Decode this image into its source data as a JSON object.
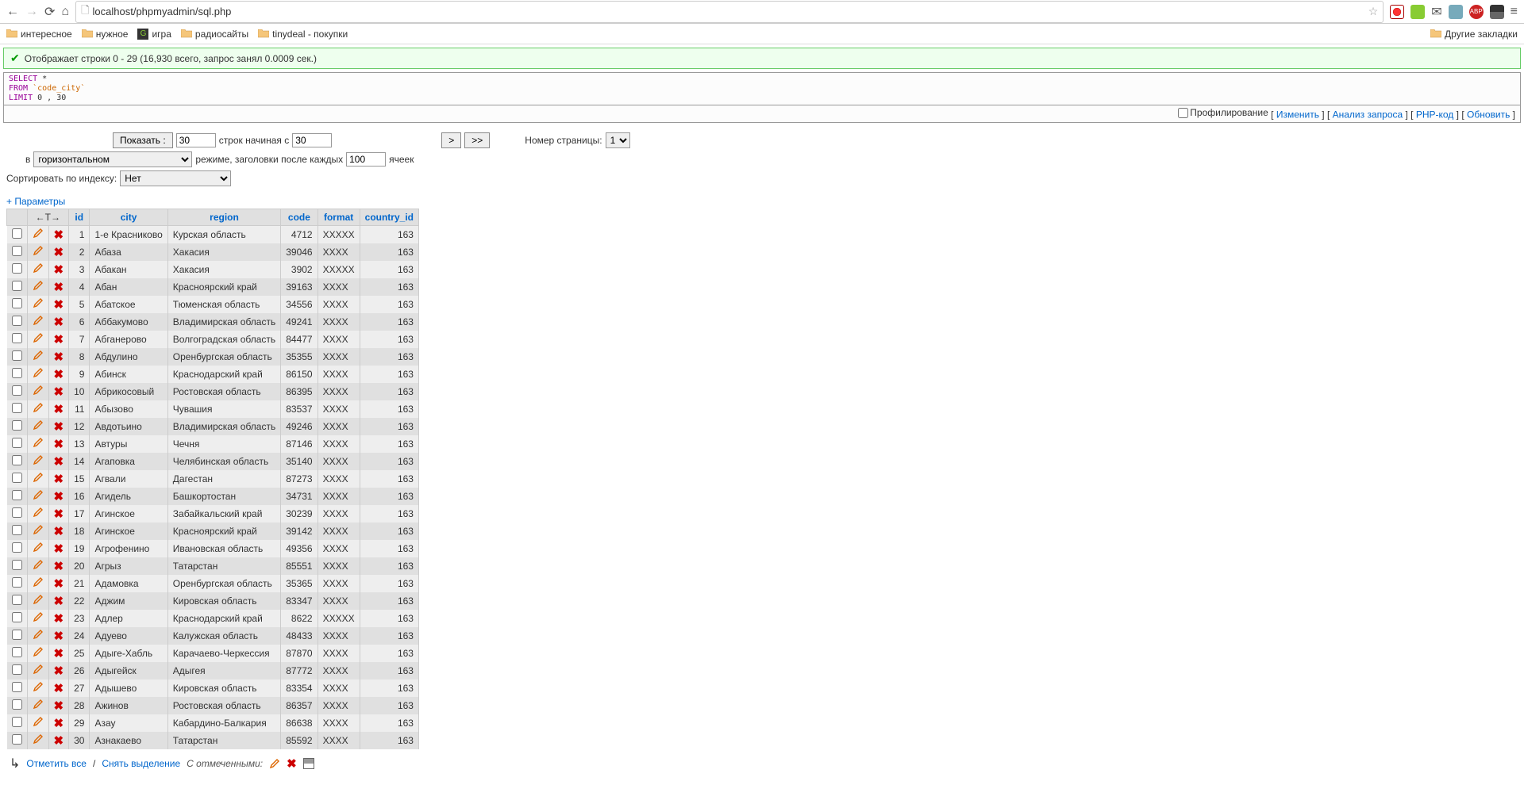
{
  "browser": {
    "url": "localhost/phpmyadmin/sql.php"
  },
  "bookmarks": {
    "items": [
      "интересное",
      "нужное",
      "игра",
      "радиосайты",
      "tinydeal - покупки"
    ],
    "right": "Другие закладки"
  },
  "status": "Отображает строки 0 - 29 (16,930 всего, запрос занял 0.0009 сек.)",
  "sql": {
    "line1_kw": "SELECT",
    "line1_rest": " *",
    "line2_kw": "FROM",
    "line2_rest": " `code_city`",
    "line3_kw": "LIMIT",
    "line3_rest": " 0 , 30"
  },
  "sql_links": {
    "profiling": "Профилирование",
    "edit": "Изменить",
    "analyze": "Анализ запроса",
    "php": "PHP-код",
    "refresh": "Обновить"
  },
  "controls": {
    "show_btn": "Показать :",
    "rows_count": "30",
    "rows_starting_label": "строк начиная с",
    "rows_starting": "30",
    "nav_next": ">",
    "nav_last": ">>",
    "page_label": "Номер страницы:",
    "page_value": "1",
    "in_label": "в",
    "mode_value": "горизонтальном",
    "mode_suffix": "режиме, заголовки после каждых",
    "repeat_headers": "100",
    "cells": "ячеек",
    "sort_label": "Сортировать по индексу:",
    "sort_value": "Нет",
    "params": "+ Параметры"
  },
  "table": {
    "headers": [
      "id",
      "city",
      "region",
      "code",
      "format",
      "country_id"
    ],
    "rows": [
      {
        "id": 1,
        "city": "1-е Красниково",
        "region": "Курская область",
        "code": 4712,
        "format": "XXXXX",
        "country_id": 163
      },
      {
        "id": 2,
        "city": "Абаза",
        "region": "Хакасия",
        "code": 39046,
        "format": "XXXX",
        "country_id": 163
      },
      {
        "id": 3,
        "city": "Абакан",
        "region": "Хакасия",
        "code": 3902,
        "format": "XXXXX",
        "country_id": 163
      },
      {
        "id": 4,
        "city": "Абан",
        "region": "Красноярский край",
        "code": 39163,
        "format": "XXXX",
        "country_id": 163
      },
      {
        "id": 5,
        "city": "Абатское",
        "region": "Тюменская область",
        "code": 34556,
        "format": "XXXX",
        "country_id": 163
      },
      {
        "id": 6,
        "city": "Аббакумово",
        "region": "Владимирская область",
        "code": 49241,
        "format": "XXXX",
        "country_id": 163
      },
      {
        "id": 7,
        "city": "Абганерово",
        "region": "Волгоградская область",
        "code": 84477,
        "format": "XXXX",
        "country_id": 163
      },
      {
        "id": 8,
        "city": "Абдулино",
        "region": "Оренбургская область",
        "code": 35355,
        "format": "XXXX",
        "country_id": 163
      },
      {
        "id": 9,
        "city": "Абинск",
        "region": "Краснодарский край",
        "code": 86150,
        "format": "XXXX",
        "country_id": 163
      },
      {
        "id": 10,
        "city": "Абрикосовый",
        "region": "Ростовская область",
        "code": 86395,
        "format": "XXXX",
        "country_id": 163
      },
      {
        "id": 11,
        "city": "Абызово",
        "region": "Чувашия",
        "code": 83537,
        "format": "XXXX",
        "country_id": 163
      },
      {
        "id": 12,
        "city": "Авдотьино",
        "region": "Владимирская область",
        "code": 49246,
        "format": "XXXX",
        "country_id": 163
      },
      {
        "id": 13,
        "city": "Автуры",
        "region": "Чечня",
        "code": 87146,
        "format": "XXXX",
        "country_id": 163
      },
      {
        "id": 14,
        "city": "Агаповка",
        "region": "Челябинская область",
        "code": 35140,
        "format": "XXXX",
        "country_id": 163
      },
      {
        "id": 15,
        "city": "Агвали",
        "region": "Дагестан",
        "code": 87273,
        "format": "XXXX",
        "country_id": 163
      },
      {
        "id": 16,
        "city": "Агидель",
        "region": "Башкортостан",
        "code": 34731,
        "format": "XXXX",
        "country_id": 163
      },
      {
        "id": 17,
        "city": "Агинское",
        "region": "Забайкальский край",
        "code": 30239,
        "format": "XXXX",
        "country_id": 163
      },
      {
        "id": 18,
        "city": "Агинское",
        "region": "Красноярский край",
        "code": 39142,
        "format": "XXXX",
        "country_id": 163
      },
      {
        "id": 19,
        "city": "Агрофенино",
        "region": "Ивановская область",
        "code": 49356,
        "format": "XXXX",
        "country_id": 163
      },
      {
        "id": 20,
        "city": "Агрыз",
        "region": "Татарстан",
        "code": 85551,
        "format": "XXXX",
        "country_id": 163
      },
      {
        "id": 21,
        "city": "Адамовка",
        "region": "Оренбургская область",
        "code": 35365,
        "format": "XXXX",
        "country_id": 163
      },
      {
        "id": 22,
        "city": "Аджим",
        "region": "Кировская область",
        "code": 83347,
        "format": "XXXX",
        "country_id": 163
      },
      {
        "id": 23,
        "city": "Адлер",
        "region": "Краснодарский край",
        "code": 8622,
        "format": "XXXXX",
        "country_id": 163
      },
      {
        "id": 24,
        "city": "Адуево",
        "region": "Калужская область",
        "code": 48433,
        "format": "XXXX",
        "country_id": 163
      },
      {
        "id": 25,
        "city": "Адыге-Хабль",
        "region": "Карачаево-Черкессия",
        "code": 87870,
        "format": "XXXX",
        "country_id": 163
      },
      {
        "id": 26,
        "city": "Адыгейск",
        "region": "Адыгея",
        "code": 87772,
        "format": "XXXX",
        "country_id": 163
      },
      {
        "id": 27,
        "city": "Адышево",
        "region": "Кировская область",
        "code": 83354,
        "format": "XXXX",
        "country_id": 163
      },
      {
        "id": 28,
        "city": "Ажинов",
        "region": "Ростовская область",
        "code": 86357,
        "format": "XXXX",
        "country_id": 163
      },
      {
        "id": 29,
        "city": "Азау",
        "region": "Кабардино-Балкария",
        "code": 86638,
        "format": "XXXX",
        "country_id": 163
      },
      {
        "id": 30,
        "city": "Азнакаево",
        "region": "Татарстан",
        "code": 85592,
        "format": "XXXX",
        "country_id": 163
      }
    ]
  },
  "footer": {
    "check_all": "Отметить все",
    "uncheck_all": "Снять выделение",
    "with_selected": "С отмеченными:"
  }
}
